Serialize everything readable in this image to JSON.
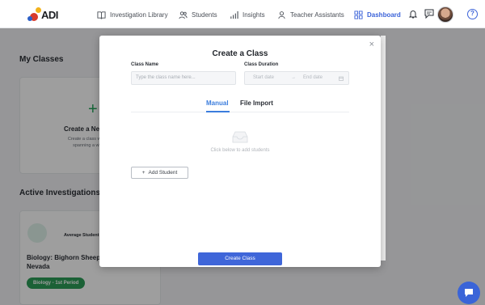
{
  "app": {
    "logo_text": "ADI"
  },
  "nav": {
    "items": [
      {
        "label": "Investigation Library",
        "icon": "book-icon"
      },
      {
        "label": "Students",
        "icon": "users-icon"
      },
      {
        "label": "Insights",
        "icon": "bar-chart-icon"
      },
      {
        "label": "Teacher Assistants",
        "icon": "user-icon"
      },
      {
        "label": "Dashboard",
        "icon": "grid-icon",
        "active": true
      }
    ],
    "help": "?"
  },
  "dashboard": {
    "my_classes_title": "My Classes",
    "create_card": {
      "plus": "+",
      "title": "Create a New",
      "desc_line1": "Create a class with in",
      "desc_line2": "spanning a whol"
    },
    "active_title": "Active Investigations",
    "investigation": {
      "avg_label": "Average Student S",
      "name_line1": "Biology: Bighorn Sheep an",
      "name_line2": "Nevada",
      "badge": "Biology - 1st Period"
    }
  },
  "modal": {
    "title": "Create a Class",
    "close": "×",
    "class_name": {
      "label": "Class Name",
      "placeholder": "Type the class name here..."
    },
    "class_duration": {
      "label": "Class Duration",
      "start_placeholder": "Start date",
      "arrow": "→",
      "end_placeholder": "End date"
    },
    "tabs": [
      {
        "label": "Manual",
        "active": true
      },
      {
        "label": "File Import"
      }
    ],
    "empty_text": "Click below to add students",
    "add_student": "Add Student",
    "add_symbol": "+",
    "submit": "Create Class"
  },
  "colors": {
    "accent": "#3f66d9",
    "tab_active": "#3b7ddd",
    "badge": "#2d9d57",
    "plus_green": "#22a35a"
  }
}
